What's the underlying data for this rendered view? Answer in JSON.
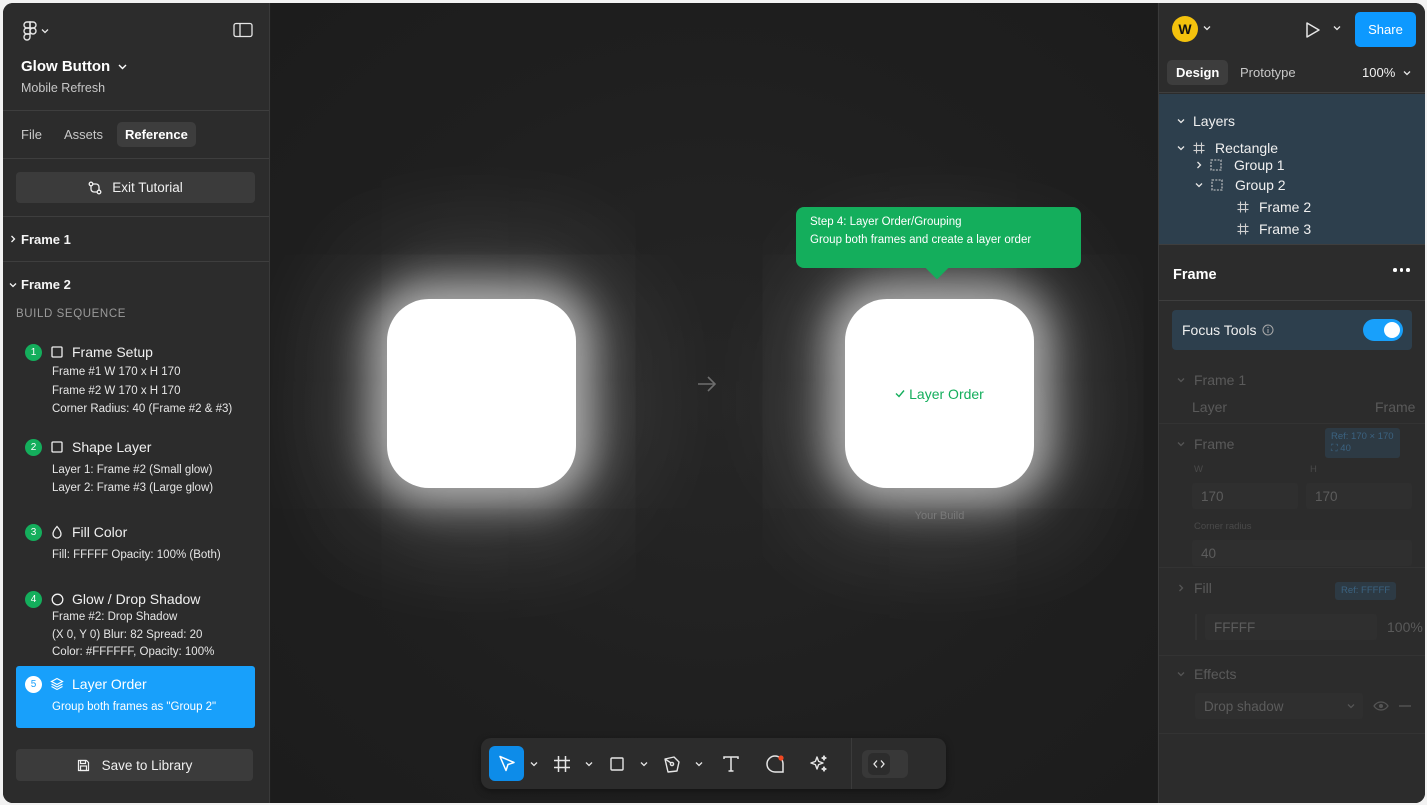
{
  "file": {
    "title": "Glow Button",
    "subtitle": "Mobile Refresh"
  },
  "left_tabs": [
    "File",
    "Assets",
    "Reference"
  ],
  "exit_tutorial_label": "Exit Tutorial",
  "frames": {
    "frame1": "Frame 1",
    "frame2": "Frame 2"
  },
  "build_sequence_label": "BUILD SEQUENCE",
  "steps": [
    {
      "num": "1",
      "title": "Frame Setup",
      "icon": "square-icon",
      "lines": [
        "Frame #1 W 170 x H 170",
        "Frame #2 W 170 x H 170",
        "Corner Radius: 40 (Frame #2 & #3)"
      ]
    },
    {
      "num": "2",
      "title": "Shape Layer",
      "icon": "square-icon",
      "lines": [
        "Layer 1: Frame #2  (Small glow)",
        "Layer 2: Frame #3 (Large glow)"
      ]
    },
    {
      "num": "3",
      "title": "Fill Color",
      "icon": "drop-icon",
      "lines": [
        "Fill: FFFFF Opacity: 100% (Both)"
      ]
    },
    {
      "num": "4",
      "title": "Glow / Drop Shadow",
      "icon": "circle-icon",
      "lines": [
        "Frame #2: Drop Shadow",
        "(X 0, Y 0) Blur: 82  Spread: 20",
        "Color: #FFFFFF, Opacity: 100%"
      ]
    },
    {
      "num": "5",
      "title": "Layer Order",
      "icon": "layers-icon",
      "lines": [
        "Group both frames as \"Group 2\""
      ]
    }
  ],
  "save_library_label": "Save to Library",
  "canvas": {
    "tooltip_title": "Step 4: Layer Order/Grouping",
    "tooltip_body": "Group both frames and create a layer order",
    "build_label": "Layer Order",
    "your_build": "Your Build"
  },
  "toolbar": [
    "move-tool",
    "frame-tool",
    "shape-tool",
    "pen-tool",
    "text-tool",
    "comment-tool",
    "ai-tool",
    "dev-mode-toggle"
  ],
  "right": {
    "avatar": "W",
    "share_label": "Share",
    "tabs": [
      "Design",
      "Prototype"
    ],
    "zoom": "100%",
    "layers_title": "Layers",
    "layers": [
      "Rectangle",
      "Group 1",
      "Group 2",
      "Frame 2",
      "Frame 3"
    ],
    "frame_heading": "Frame",
    "focus_tools": "Focus Tools",
    "sections": {
      "frame1": "Frame 1",
      "layer_label": "Layer",
      "layer_value": "Frame",
      "frame": "Frame",
      "ref_size": "Ref: 170 × 170",
      "ref_radius": "40",
      "w_label": "W",
      "h_label": "H",
      "w": "170",
      "h": "170",
      "corner_radius_label": "Corner radius",
      "corner_radius": "40",
      "fill": "Fill",
      "fill_ref": "Ref: FFFFF",
      "fill_value": "FFFFF",
      "fill_opacity": "100%",
      "effects": "Effects",
      "effect_type": "Drop shadow"
    }
  },
  "colors": {
    "accent": "#18a0fb",
    "success": "#14ae5c",
    "panel": "#2c2c2c",
    "canvas": "#1e1e1e"
  }
}
